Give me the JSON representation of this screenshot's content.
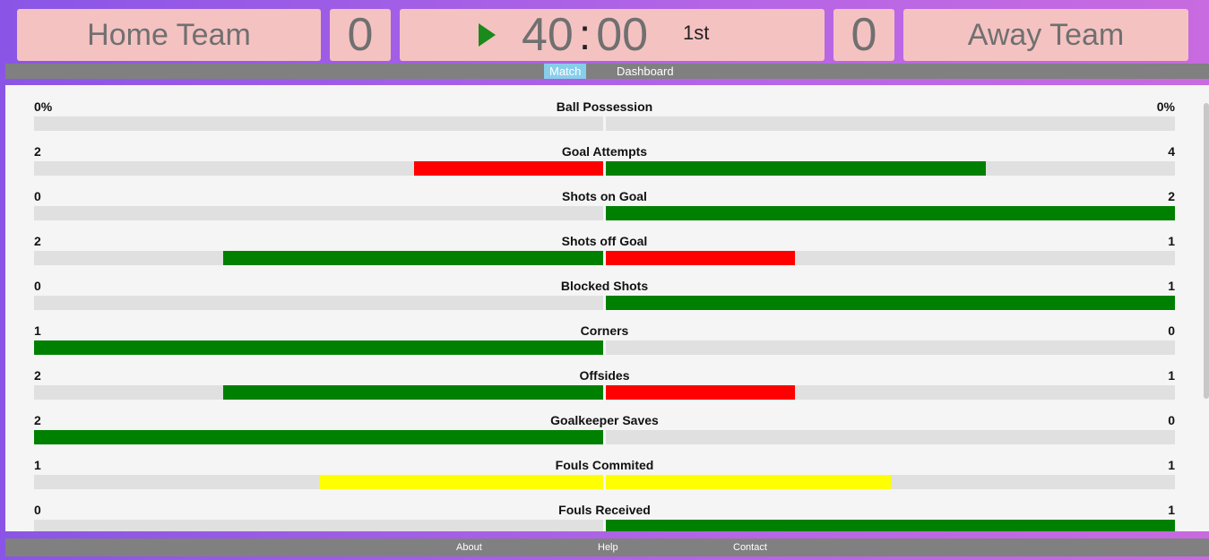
{
  "scoreboard": {
    "home_team": "Home Team",
    "home_score": "0",
    "clock_minutes": "40",
    "clock_separator": ":",
    "clock_seconds": "00",
    "period": "1st",
    "away_score": "0",
    "away_team": "Away Team"
  },
  "nav": {
    "tabs": [
      "Match",
      "Dashboard"
    ],
    "active_tab": "Match"
  },
  "stats": [
    {
      "label": "Ball Possession",
      "home": "0%",
      "away": "0%",
      "home_fill": 0,
      "away_fill": 0,
      "home_color": "",
      "away_color": ""
    },
    {
      "label": "Goal Attempts",
      "home": "2",
      "away": "4",
      "home_fill": 0.333,
      "away_fill": 0.667,
      "home_color": "#ff0000",
      "away_color": "#008000"
    },
    {
      "label": "Shots on Goal",
      "home": "0",
      "away": "2",
      "home_fill": 0,
      "away_fill": 1,
      "home_color": "",
      "away_color": "#008000"
    },
    {
      "label": "Shots off Goal",
      "home": "2",
      "away": "1",
      "home_fill": 0.667,
      "away_fill": 0.333,
      "home_color": "#008000",
      "away_color": "#ff0000"
    },
    {
      "label": "Blocked Shots",
      "home": "0",
      "away": "1",
      "home_fill": 0,
      "away_fill": 1,
      "home_color": "",
      "away_color": "#008000"
    },
    {
      "label": "Corners",
      "home": "1",
      "away": "0",
      "home_fill": 1,
      "away_fill": 0,
      "home_color": "#008000",
      "away_color": ""
    },
    {
      "label": "Offsides",
      "home": "2",
      "away": "1",
      "home_fill": 0.667,
      "away_fill": 0.333,
      "home_color": "#008000",
      "away_color": "#ff0000"
    },
    {
      "label": "Goalkeeper Saves",
      "home": "2",
      "away": "0",
      "home_fill": 1,
      "away_fill": 0,
      "home_color": "#008000",
      "away_color": ""
    },
    {
      "label": "Fouls Commited",
      "home": "1",
      "away": "1",
      "home_fill": 0.5,
      "away_fill": 0.5,
      "home_color": "#ffff00",
      "away_color": "#ffff00"
    },
    {
      "label": "Fouls Received",
      "home": "0",
      "away": "1",
      "home_fill": 0,
      "away_fill": 1,
      "home_color": "",
      "away_color": "#008000"
    }
  ],
  "footer": {
    "about": "About",
    "help": "Help",
    "contact": "Contact"
  },
  "colors": {
    "accent_win": "#008000",
    "accent_lose": "#ff0000",
    "accent_equal": "#ffff00",
    "score_box": "#f5c2c2",
    "active_tab": "#87ceeb"
  },
  "icons": {
    "play": "play-icon"
  }
}
